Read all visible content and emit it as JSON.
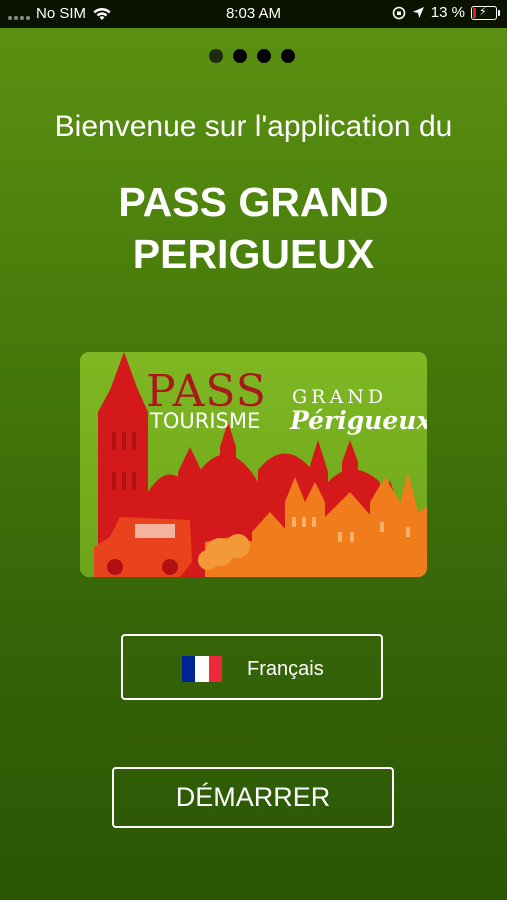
{
  "status_bar": {
    "carrier": "No SIM",
    "time": "8:03 AM",
    "battery": "13 %",
    "battery_level": 0.13
  },
  "pager": {
    "total": 4,
    "active": 0
  },
  "welcome_text": "Bienvenue sur l'application du",
  "title_lines": [
    "PASS GRAND",
    "PERIGUEUX"
  ],
  "card": {
    "pass": "PASS",
    "tourisme": "TOURISME",
    "grand": "GRAND",
    "perigueux": "Périgueux"
  },
  "language": {
    "label": "Français",
    "flag_colors": [
      "#002395",
      "#ffffff",
      "#ed2939"
    ]
  },
  "start_label": "DÉMARRER",
  "colors": {
    "background_top": "#5d9312",
    "background_bottom": "#2b5604",
    "card_green": "#78b21e",
    "card_red": "#d4191b",
    "card_orange": "#f07c1c"
  }
}
